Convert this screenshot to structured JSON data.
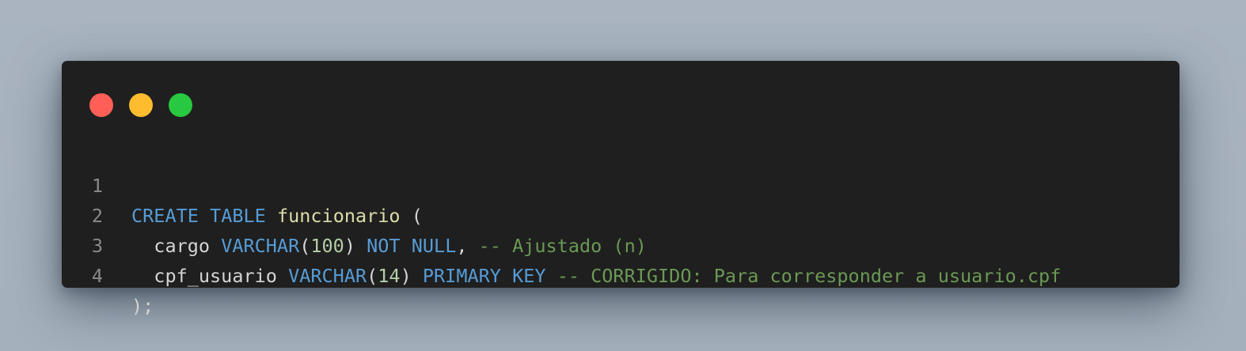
{
  "window": {
    "traffic_lights": [
      "close",
      "minimize",
      "maximize"
    ],
    "colors": {
      "close": "#ff5f57",
      "minimize": "#febc2e",
      "maximize": "#28c840",
      "background": "#1f1f1f",
      "keyword": "#569cd6",
      "function": "#dcdcaa",
      "number": "#b5cea8",
      "comment": "#6a9955",
      "text": "#d4d4d4"
    }
  },
  "code": {
    "language": "sql",
    "lines": [
      {
        "number": "1",
        "tokens": [
          {
            "t": "kw",
            "v": "CREATE"
          },
          {
            "t": "pl",
            "v": " "
          },
          {
            "t": "kw",
            "v": "TABLE"
          },
          {
            "t": "pl",
            "v": " "
          },
          {
            "t": "fn",
            "v": "funcionario"
          },
          {
            "t": "pl",
            "v": " ("
          }
        ]
      },
      {
        "number": "2",
        "tokens": [
          {
            "t": "pl",
            "v": "  cargo "
          },
          {
            "t": "kw",
            "v": "VARCHAR"
          },
          {
            "t": "pl",
            "v": "("
          },
          {
            "t": "num",
            "v": "100"
          },
          {
            "t": "pl",
            "v": ") "
          },
          {
            "t": "kw",
            "v": "NOT"
          },
          {
            "t": "pl",
            "v": " "
          },
          {
            "t": "kw",
            "v": "NULL"
          },
          {
            "t": "pl",
            "v": ", "
          },
          {
            "t": "cm",
            "v": "-- Ajustado (n)"
          }
        ]
      },
      {
        "number": "3",
        "tokens": [
          {
            "t": "pl",
            "v": "  cpf_usuario "
          },
          {
            "t": "kw",
            "v": "VARCHAR"
          },
          {
            "t": "pl",
            "v": "("
          },
          {
            "t": "num",
            "v": "14"
          },
          {
            "t": "pl",
            "v": ") "
          },
          {
            "t": "kw",
            "v": "PRIMARY"
          },
          {
            "t": "pl",
            "v": " "
          },
          {
            "t": "kw",
            "v": "KEY"
          },
          {
            "t": "pl",
            "v": " "
          },
          {
            "t": "cm",
            "v": "-- CORRIGIDO: Para corresponder a usuario.cpf"
          }
        ]
      },
      {
        "number": "4",
        "tokens": [
          {
            "t": "pl",
            "v": ");"
          }
        ]
      }
    ]
  }
}
